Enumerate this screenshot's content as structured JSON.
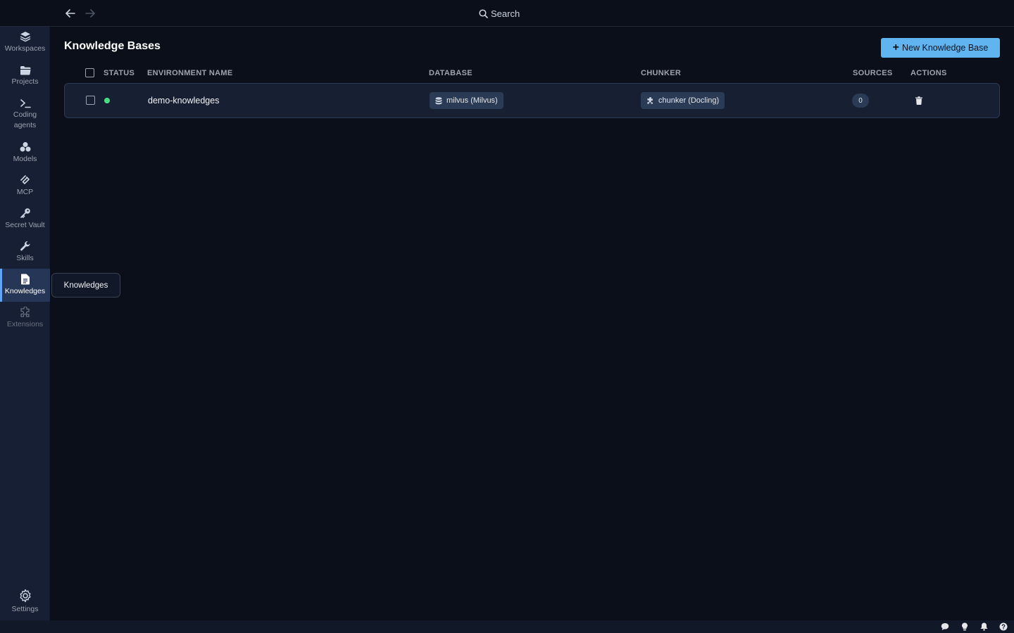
{
  "titlebar": {
    "search_label": "Search"
  },
  "sidebar": {
    "items": [
      {
        "label": "Workspaces",
        "icon": "layers-icon"
      },
      {
        "label": "Projects",
        "icon": "folder-icon"
      },
      {
        "label": "Coding agents",
        "icon": "terminal-icon"
      },
      {
        "label": "Models",
        "icon": "cubes-icon"
      },
      {
        "label": "MCP",
        "icon": "mcp-icon"
      },
      {
        "label": "Secret Vault",
        "icon": "key-icon"
      },
      {
        "label": "Skills",
        "icon": "wrench-icon"
      },
      {
        "label": "Knowledges",
        "icon": "document-icon",
        "active": true
      },
      {
        "label": "Extensions",
        "icon": "puzzle-icon"
      }
    ],
    "settings_label": "Settings"
  },
  "tooltip": {
    "text": "Knowledges"
  },
  "main": {
    "title": "Knowledge Bases",
    "new_button_label": "New Knowledge Base",
    "columns": {
      "status": "STATUS",
      "environment_name": "ENVIRONMENT NAME",
      "database": "DATABASE",
      "chunker": "CHUNKER",
      "sources": "SOURCES",
      "actions": "ACTIONS"
    },
    "rows": [
      {
        "status": "running",
        "environment_name": "demo-knowledges",
        "database": "milvus (Milvus)",
        "chunker": "chunker (Docling)",
        "sources": "0"
      }
    ]
  },
  "colors": {
    "accent": "#60b5f1",
    "status_ok": "#4ade80",
    "background": "#0b0f19",
    "sidebar": "#161f33"
  }
}
